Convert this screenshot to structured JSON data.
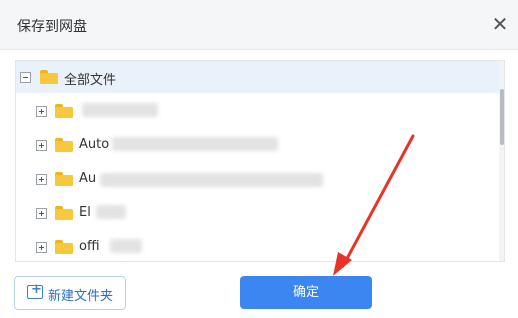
{
  "dialog": {
    "title": "保存到网盘",
    "close_glyph": "✕"
  },
  "tree": {
    "root": {
      "label": "全部文件",
      "expanded": true,
      "selected": true
    },
    "items": [
      {
        "label": ""
      },
      {
        "label": "Auto"
      },
      {
        "label": "Au"
      },
      {
        "label": "El"
      },
      {
        "label": "offi"
      }
    ]
  },
  "footer": {
    "new_folder_label": "新建文件夹",
    "confirm_label": "确定"
  },
  "colors": {
    "accent": "#3b86f0",
    "folder": "#f7c83e",
    "annotation_arrow": "#e8332a"
  },
  "icons": {
    "close": "close-icon",
    "folder": "folder-icon",
    "expand": "plus-square-icon",
    "collapse": "minus-square-icon",
    "new_folder": "folder-plus-icon"
  }
}
